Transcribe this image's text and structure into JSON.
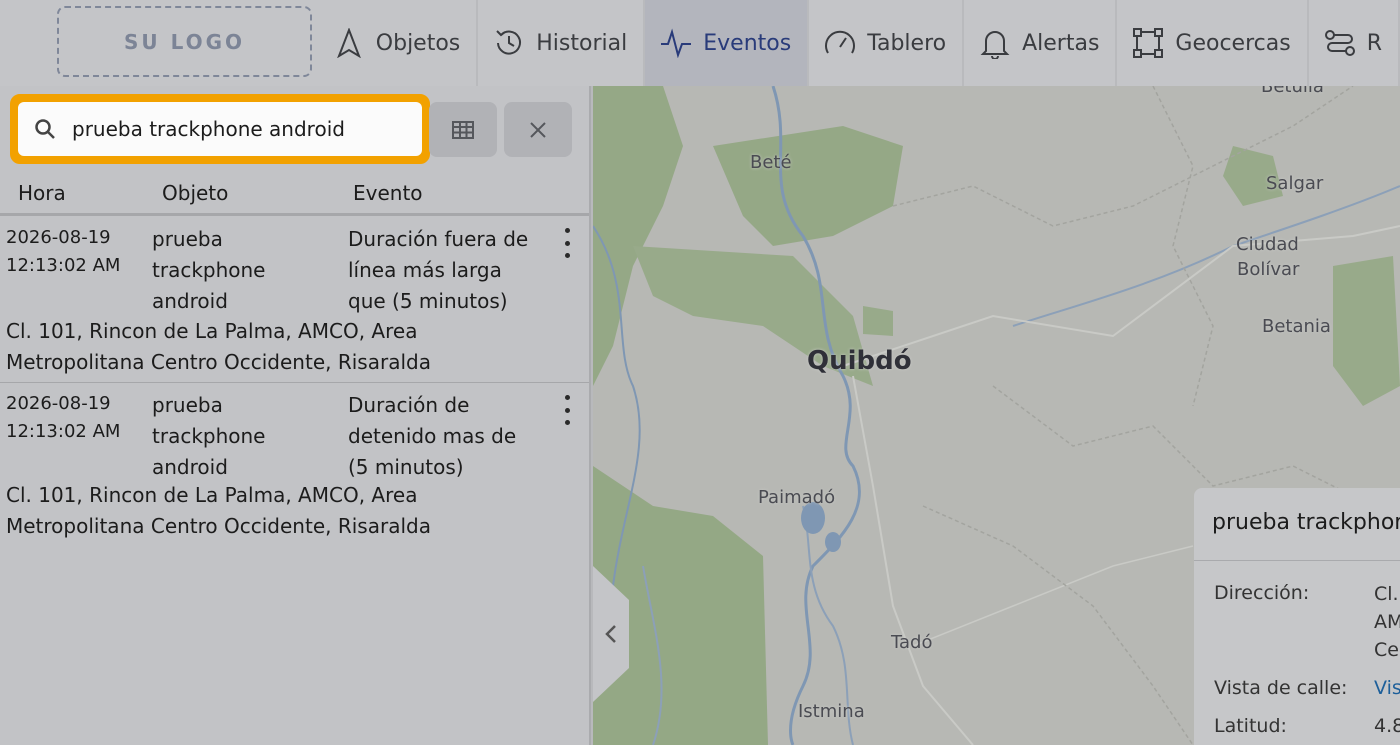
{
  "logo": {
    "text": "SU LOGO"
  },
  "nav": {
    "items": [
      {
        "label": "Objetos",
        "icon": "navigation-icon",
        "active": false
      },
      {
        "label": "Historial",
        "icon": "history-icon",
        "active": false
      },
      {
        "label": "Eventos",
        "icon": "activity-icon",
        "active": true
      },
      {
        "label": "Tablero",
        "icon": "gauge-icon",
        "active": false
      },
      {
        "label": "Alertas",
        "icon": "bell-icon",
        "active": false
      },
      {
        "label": "Geocercas",
        "icon": "geofence-icon",
        "active": false
      },
      {
        "label": "R",
        "icon": "route-icon",
        "active": false
      }
    ]
  },
  "search": {
    "value": "prueba trackphone android",
    "placeholder": ""
  },
  "table": {
    "headers": {
      "time": "Hora",
      "object": "Objeto",
      "event": "Evento"
    },
    "rows": [
      {
        "date": "2026-08-19",
        "time": "12:13:02 AM",
        "object_lines": [
          "prueba",
          "trackphone",
          "android"
        ],
        "event_lines": [
          "Duración fuera de",
          "línea más larga",
          "que (5 minutos)"
        ],
        "address_lines": [
          "Cl. 101, Rincon de La Palma, AMCO, Area",
          "Metropolitana Centro Occidente, Risaralda"
        ]
      },
      {
        "date": "2026-08-19",
        "time": "12:13:02 AM",
        "object_lines": [
          "prueba",
          "trackphone",
          "android"
        ],
        "event_lines": [
          "Duración de",
          "detenido mas de",
          "(5 minutos)"
        ],
        "address_lines": [
          "Cl. 101, Rincon de La Palma, AMCO, Area",
          "Metropolitana Centro Occidente, Risaralda"
        ]
      }
    ]
  },
  "map": {
    "towns": [
      "Betulia",
      "Beté",
      "Salgar",
      "Ciudad",
      "Bolívar",
      "Betania",
      "Quibdó",
      "Paimadó",
      "Tadó",
      "Istmina"
    ]
  },
  "popup": {
    "title": "prueba trackphone",
    "address_label": "Dirección:",
    "address_lines": [
      "Cl.",
      "AM",
      "Ce"
    ],
    "street_label": "Vista de calle:",
    "street_value": "Vis",
    "lat_label": "Latitud:",
    "lat_value": "4.8"
  },
  "colors": {
    "accent": "#f2a100",
    "active_nav": "#293b7a",
    "link": "#1d5f9a"
  }
}
